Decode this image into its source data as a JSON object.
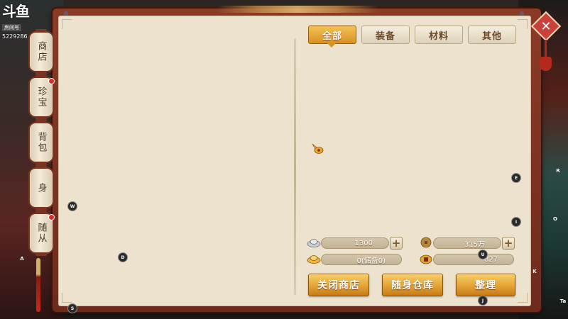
{
  "stream": {
    "logo": "斗鱼",
    "room_label": "房间号",
    "room_id": "5229286"
  },
  "side_tabs": [
    {
      "label": "商店",
      "badge": false
    },
    {
      "label": "珍宝",
      "badge": true
    },
    {
      "label": "背包",
      "badge": false
    },
    {
      "label": "身",
      "badge": false
    },
    {
      "label": "随从",
      "badge": true
    }
  ],
  "category_tabs": [
    {
      "label": "全部",
      "active": true
    },
    {
      "label": "装备",
      "active": false
    },
    {
      "label": "材料",
      "active": false
    },
    {
      "label": "其他",
      "active": false
    }
  ],
  "currency": {
    "silver": "1300",
    "copper": "315万",
    "gold_ingot": "0(储备0)",
    "gold_bag": "827"
  },
  "buttons": {
    "close_shop": "关闭商店",
    "portable_storage": "随身仓库",
    "organize": "整理"
  },
  "key_hints": {
    "W": "W",
    "D": "D",
    "A": "A",
    "S": "S",
    "E": "E",
    "I": "I",
    "U": "U",
    "J": "J",
    "R": "R",
    "O": "O",
    "K": "K",
    "Tab": "Ta"
  },
  "close_label": "✕",
  "icons": {
    "silver": "silver-ingot-icon",
    "copper": "copper-coin-icon",
    "gold_ingot": "gold-ingot-icon",
    "gold_bag": "gold-bag-icon"
  },
  "colors": {
    "frame": "#8a3b26",
    "paper": "#ece2cd",
    "accent_gold": "#e3a233",
    "badge_red": "#e02a2a"
  }
}
